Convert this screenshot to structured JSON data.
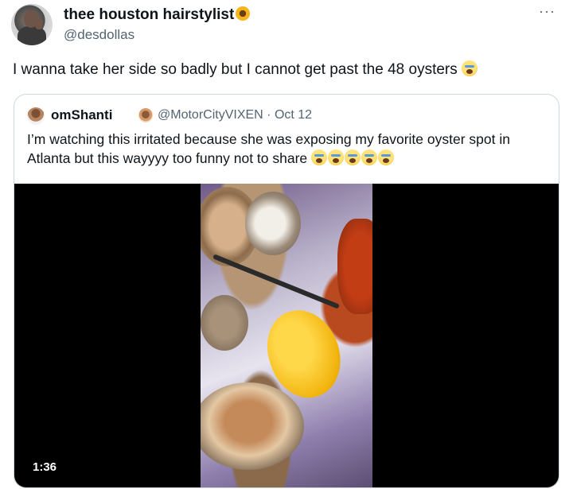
{
  "author": {
    "name": "thee houston hairstylist",
    "handle": "@desdollas"
  },
  "menu": {
    "more_label": "···"
  },
  "tweet": {
    "text": "I wanna take her side so badly but I cannot get past the 48 oysters"
  },
  "quoted": {
    "name": "omShanti",
    "handle": "@MotorCityVIXEN",
    "separator": " · ",
    "date": "Oct 12",
    "text": "I’m watching this irritated because she was exposing my favorite oyster spot in Atlanta but this wayyyy too funny not to share"
  },
  "video": {
    "timecode": "1:36"
  },
  "icons": {
    "author_suffix": "sunflower-icon",
    "tweet_suffix": "loudly-crying-face-icon",
    "quoted_badge": "woman-emoji-icon",
    "quoted_suffix_count": 5
  }
}
